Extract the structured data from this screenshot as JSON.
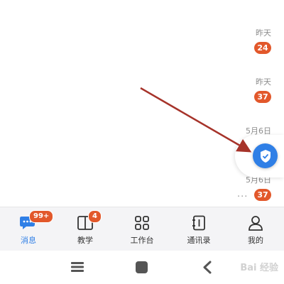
{
  "conversations": [
    {
      "time": "昨天",
      "unread": "24"
    },
    {
      "time": "昨天",
      "unread": "37"
    },
    {
      "time": "5月6日",
      "unread": ""
    },
    {
      "time": "5月6日",
      "unread": "37"
    }
  ],
  "more_glyph": "···",
  "tabs": [
    {
      "label": "消息",
      "badge": "99+",
      "icon": "chat-bubble-icon",
      "active": true
    },
    {
      "label": "教学",
      "badge": "4",
      "icon": "book-icon",
      "active": false
    },
    {
      "label": "工作台",
      "badge": "",
      "icon": "grid-icon",
      "active": false
    },
    {
      "label": "通讯录",
      "badge": "",
      "icon": "contacts-icon",
      "active": false
    },
    {
      "label": "我的",
      "badge": "",
      "icon": "person-icon",
      "active": false
    }
  ],
  "system_nav": [
    "menu-icon",
    "home-icon",
    "back-icon"
  ],
  "watermark": "Bai 经验",
  "colors": {
    "accent": "#2f7fe6",
    "badge": "#e2582b",
    "arrow": "#a6332a"
  }
}
